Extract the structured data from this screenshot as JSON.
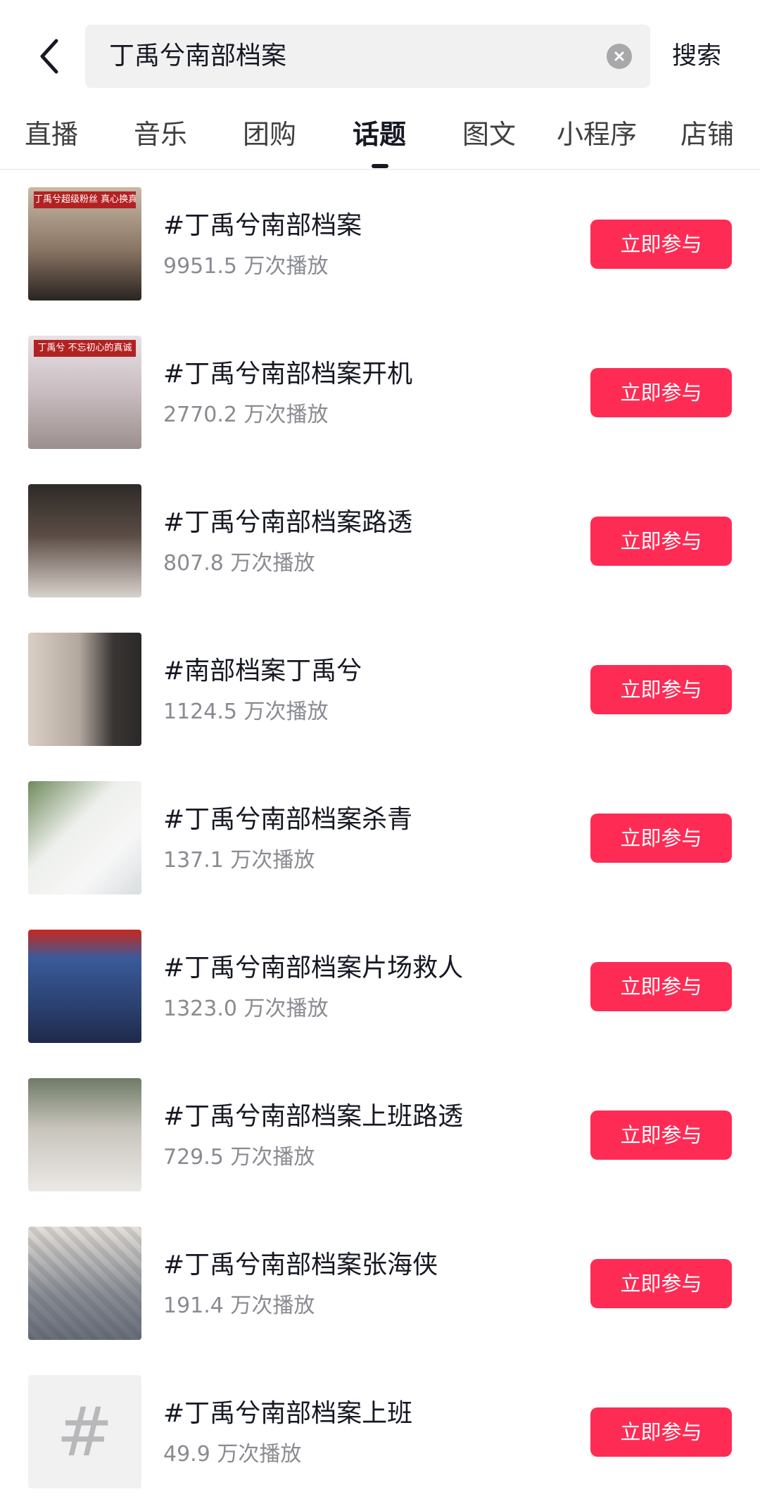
{
  "search": {
    "query": "丁禹兮南部档案",
    "search_label": "搜索",
    "back_icon": "chevron-left-icon",
    "clear_icon": "clear-circle-icon"
  },
  "tabs": [
    {
      "label": "直播",
      "active": false
    },
    {
      "label": "音乐",
      "active": false
    },
    {
      "label": "团购",
      "active": false
    },
    {
      "label": "话题",
      "active": true
    },
    {
      "label": "图文",
      "active": false
    },
    {
      "label": "小程序",
      "active": false
    },
    {
      "label": "店铺",
      "active": false
    }
  ],
  "topics": [
    {
      "title": "#丁禹兮南部档案",
      "views": "9951.5 万次播放",
      "join_label": "立即参与",
      "thumb_banner": "丁禹兮超级粉丝 真心换真心"
    },
    {
      "title": "#丁禹兮南部档案开机",
      "views": "2770.2 万次播放",
      "join_label": "立即参与",
      "thumb_banner": "丁禹兮 不忘初心的真诚"
    },
    {
      "title": "#丁禹兮南部档案路透",
      "views": "807.8 万次播放",
      "join_label": "立即参与"
    },
    {
      "title": "#南部档案丁禹兮",
      "views": "1124.5 万次播放",
      "join_label": "立即参与"
    },
    {
      "title": "#丁禹兮南部档案杀青",
      "views": "137.1 万次播放",
      "join_label": "立即参与"
    },
    {
      "title": "#丁禹兮南部档案片场救人",
      "views": "1323.0 万次播放",
      "join_label": "立即参与"
    },
    {
      "title": "#丁禹兮南部档案上班路透",
      "views": "729.5 万次播放",
      "join_label": "立即参与"
    },
    {
      "title": "#丁禹兮南部档案张海侠",
      "views": "191.4 万次播放",
      "join_label": "立即参与"
    },
    {
      "title": "#丁禹兮南部档案上班",
      "views": "49.9 万次播放",
      "join_label": "立即参与",
      "thumb_glyph": "#"
    }
  ],
  "colors": {
    "accent": "#fe2c55",
    "text_primary": "#161823",
    "text_secondary": "#8a8b91",
    "search_bg": "#f1f1f2"
  }
}
